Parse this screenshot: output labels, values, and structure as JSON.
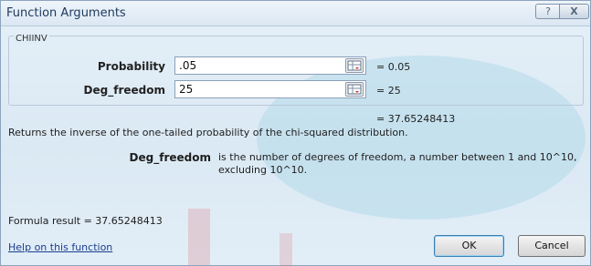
{
  "window": {
    "title": "Function Arguments"
  },
  "titlebar": {
    "help_glyph": "?",
    "close_glyph": "X"
  },
  "function": {
    "name": "CHIINV"
  },
  "args": [
    {
      "label": "Probability",
      "value": ".05",
      "evaluated": "=  0.05"
    },
    {
      "label": "Deg_freedom",
      "value": "25",
      "evaluated": "=  25"
    }
  ],
  "result_line": "=  37.65248413",
  "description": "Returns the inverse of the one-tailed probability of the chi-squared distribution.",
  "param_help": {
    "name": "Deg_freedom",
    "text": "is the number of degrees of freedom, a number between 1 and 10^10, excluding 10^10."
  },
  "formula_result": "Formula result =  37.65248413",
  "help_link": "Help on this function",
  "buttons": {
    "ok": "OK",
    "cancel": "Cancel"
  },
  "icons": {
    "ref_button": "collapse-dialog-icon"
  }
}
